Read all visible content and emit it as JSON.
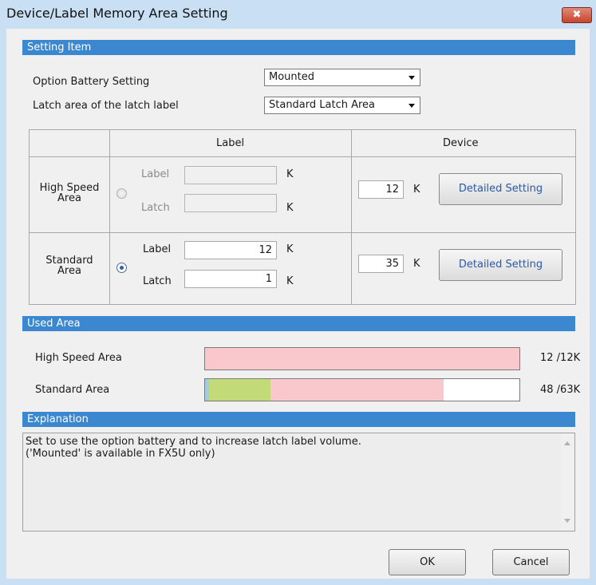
{
  "window": {
    "title": "Device/Label Memory Area Setting",
    "close_glyph": "✖"
  },
  "setting_item": {
    "header": "Setting Item",
    "option_battery_label": "Option Battery Setting",
    "option_battery_value": "Mounted",
    "latch_area_label": "Latch area of the latch label",
    "latch_area_value": "Standard Latch Area"
  },
  "grid": {
    "col_label": "Label",
    "col_device": "Device",
    "high_speed": {
      "row_title": "High Speed\nArea",
      "label_caption": "Label",
      "latch_caption": "Latch",
      "label_value": "",
      "latch_value": "",
      "unit": "K",
      "device_value": "12",
      "device_unit": "K",
      "detail_button": "Detailed Setting",
      "selected": false
    },
    "standard": {
      "row_title": "Standard\nArea",
      "label_caption": "Label",
      "latch_caption": "Latch",
      "label_value": "12",
      "latch_value": "1",
      "unit": "K",
      "device_value": "35",
      "device_unit": "K",
      "detail_button": "Detailed Setting",
      "selected": true
    }
  },
  "used_area": {
    "header": "Used Area",
    "high_speed_label": "High Speed Area",
    "high_speed_usage": "12 /12K",
    "high_speed_used": 12,
    "high_speed_total": 12,
    "standard_label": "Standard Area",
    "standard_usage": "48 /63K",
    "standard_used": 48,
    "standard_total": 63,
    "colors": {
      "pink": "#f8c8cc",
      "green": "#c2da78",
      "blue": "#9ccde8"
    }
  },
  "explanation": {
    "header": "Explanation",
    "text": "Set to use the option battery and to increase latch label volume.\n('Mounted' is available in FX5U only)"
  },
  "buttons": {
    "ok": "OK",
    "cancel": "Cancel"
  }
}
